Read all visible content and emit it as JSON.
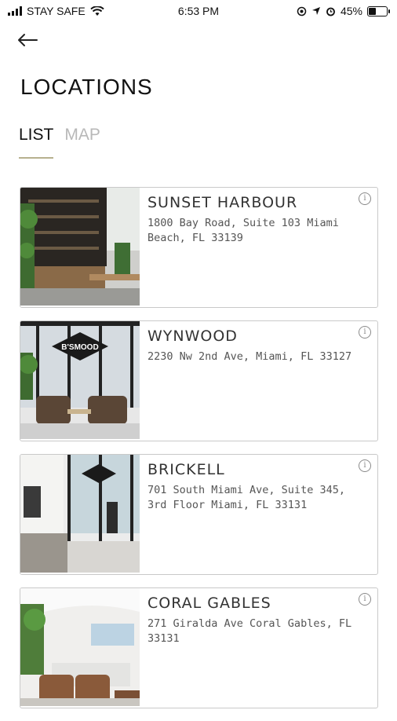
{
  "status_bar": {
    "carrier": "STAY SAFE",
    "time": "6:53 PM",
    "battery_percent": "45%",
    "battery_level": 0.45
  },
  "header": {
    "back_icon": "arrow-left-icon",
    "title": "LOCATIONS"
  },
  "tabs": [
    {
      "label": "LIST",
      "active": true
    },
    {
      "label": "MAP",
      "active": false
    }
  ],
  "locations": [
    {
      "name": "SUNSET HARBOUR",
      "address": "1800 Bay Road, Suite 103 Miami Beach, FL 33139"
    },
    {
      "name": "WYNWOOD",
      "address": "2230 Nw 2nd Ave, Miami, FL 33127",
      "sign_text": "B'SMOOD"
    },
    {
      "name": "BRICKELL",
      "address": "701 South Miami Ave, Suite 345, 3rd Floor Miami, FL 33131"
    },
    {
      "name": "CORAL GABLES",
      "address": "271 Giralda Ave Coral Gables, FL 33131"
    }
  ],
  "colors": {
    "tab_underline": "#b7b18f",
    "inactive_tab": "#b8b8b8",
    "card_border": "#c9c9c9"
  }
}
